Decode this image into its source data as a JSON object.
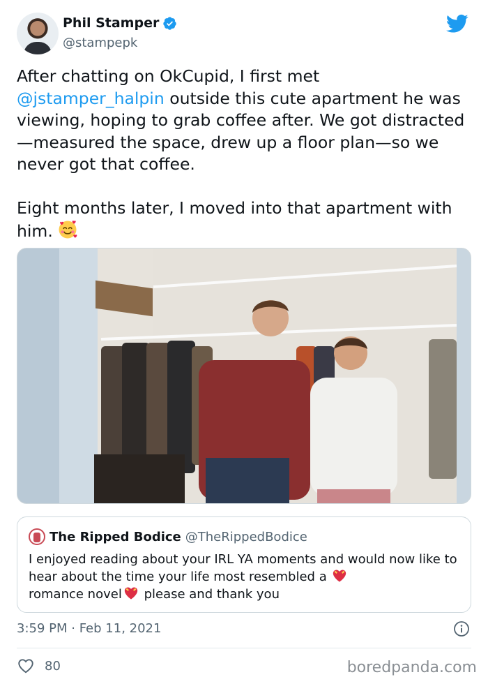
{
  "author": {
    "name": "Phil Stamper",
    "handle": "@stampepk",
    "verified": true
  },
  "tweet": {
    "para1_before": "After chatting on OkCupid, I first met\n",
    "mention": "@jstamper_halpin",
    "para1_after": " outside this cute apartment he was viewing, hoping to grab coffee after. We got distracted—measured the space, drew up a floor plan—so we never got that coffee.",
    "para2": "Eight months later, I moved into that apartment with him.",
    "emoji": "smiling-face-with-hearts"
  },
  "quote": {
    "name": "The Ripped Bodice",
    "handle": "@TheRippedBodice",
    "text_part1": "I enjoyed reading about your IRL YA  moments and would now like to hear about the time your life most resembled a",
    "text_part2": "romance novel",
    "text_part3": " please and thank you",
    "emoji": "heart-with-ribbon"
  },
  "meta": {
    "timestamp": "3:59 PM · Feb 11, 2021"
  },
  "engagement": {
    "likes": "80"
  },
  "watermark": "boredpanda.com",
  "colors": {
    "accent": "#1d9bf0",
    "secondary_text": "#536471",
    "border": "#cfd9de"
  }
}
